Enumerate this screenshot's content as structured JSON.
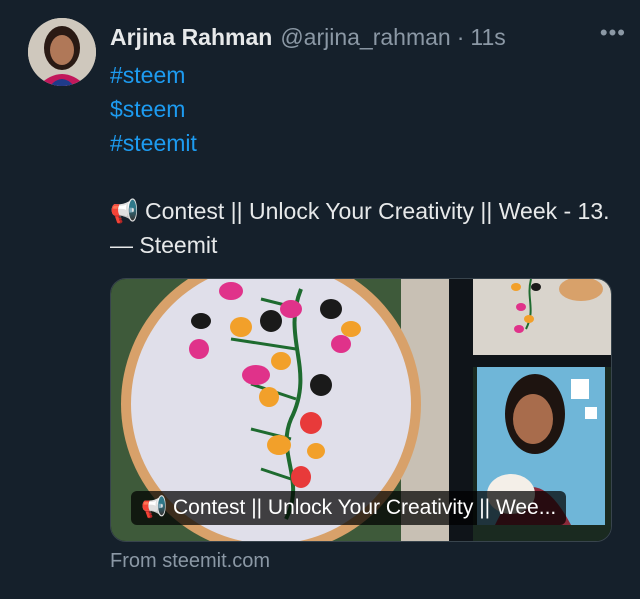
{
  "tweet": {
    "author_name": "Arjina Rahman",
    "handle": "@arjina_rahman",
    "separator": "·",
    "time": "11s",
    "more_label": "•••",
    "tags": [
      "#steem",
      "$steem",
      "#steemit"
    ],
    "contest_text": "📢 Contest || Unlock Your Creativity || Week - 13. — Steemit"
  },
  "card": {
    "caption": "📢 Contest || Unlock Your Creativity || Wee...",
    "source": "From steemit.com"
  },
  "icons": [
    "avatar-photo",
    "more-icon",
    "megaphone-icon"
  ]
}
